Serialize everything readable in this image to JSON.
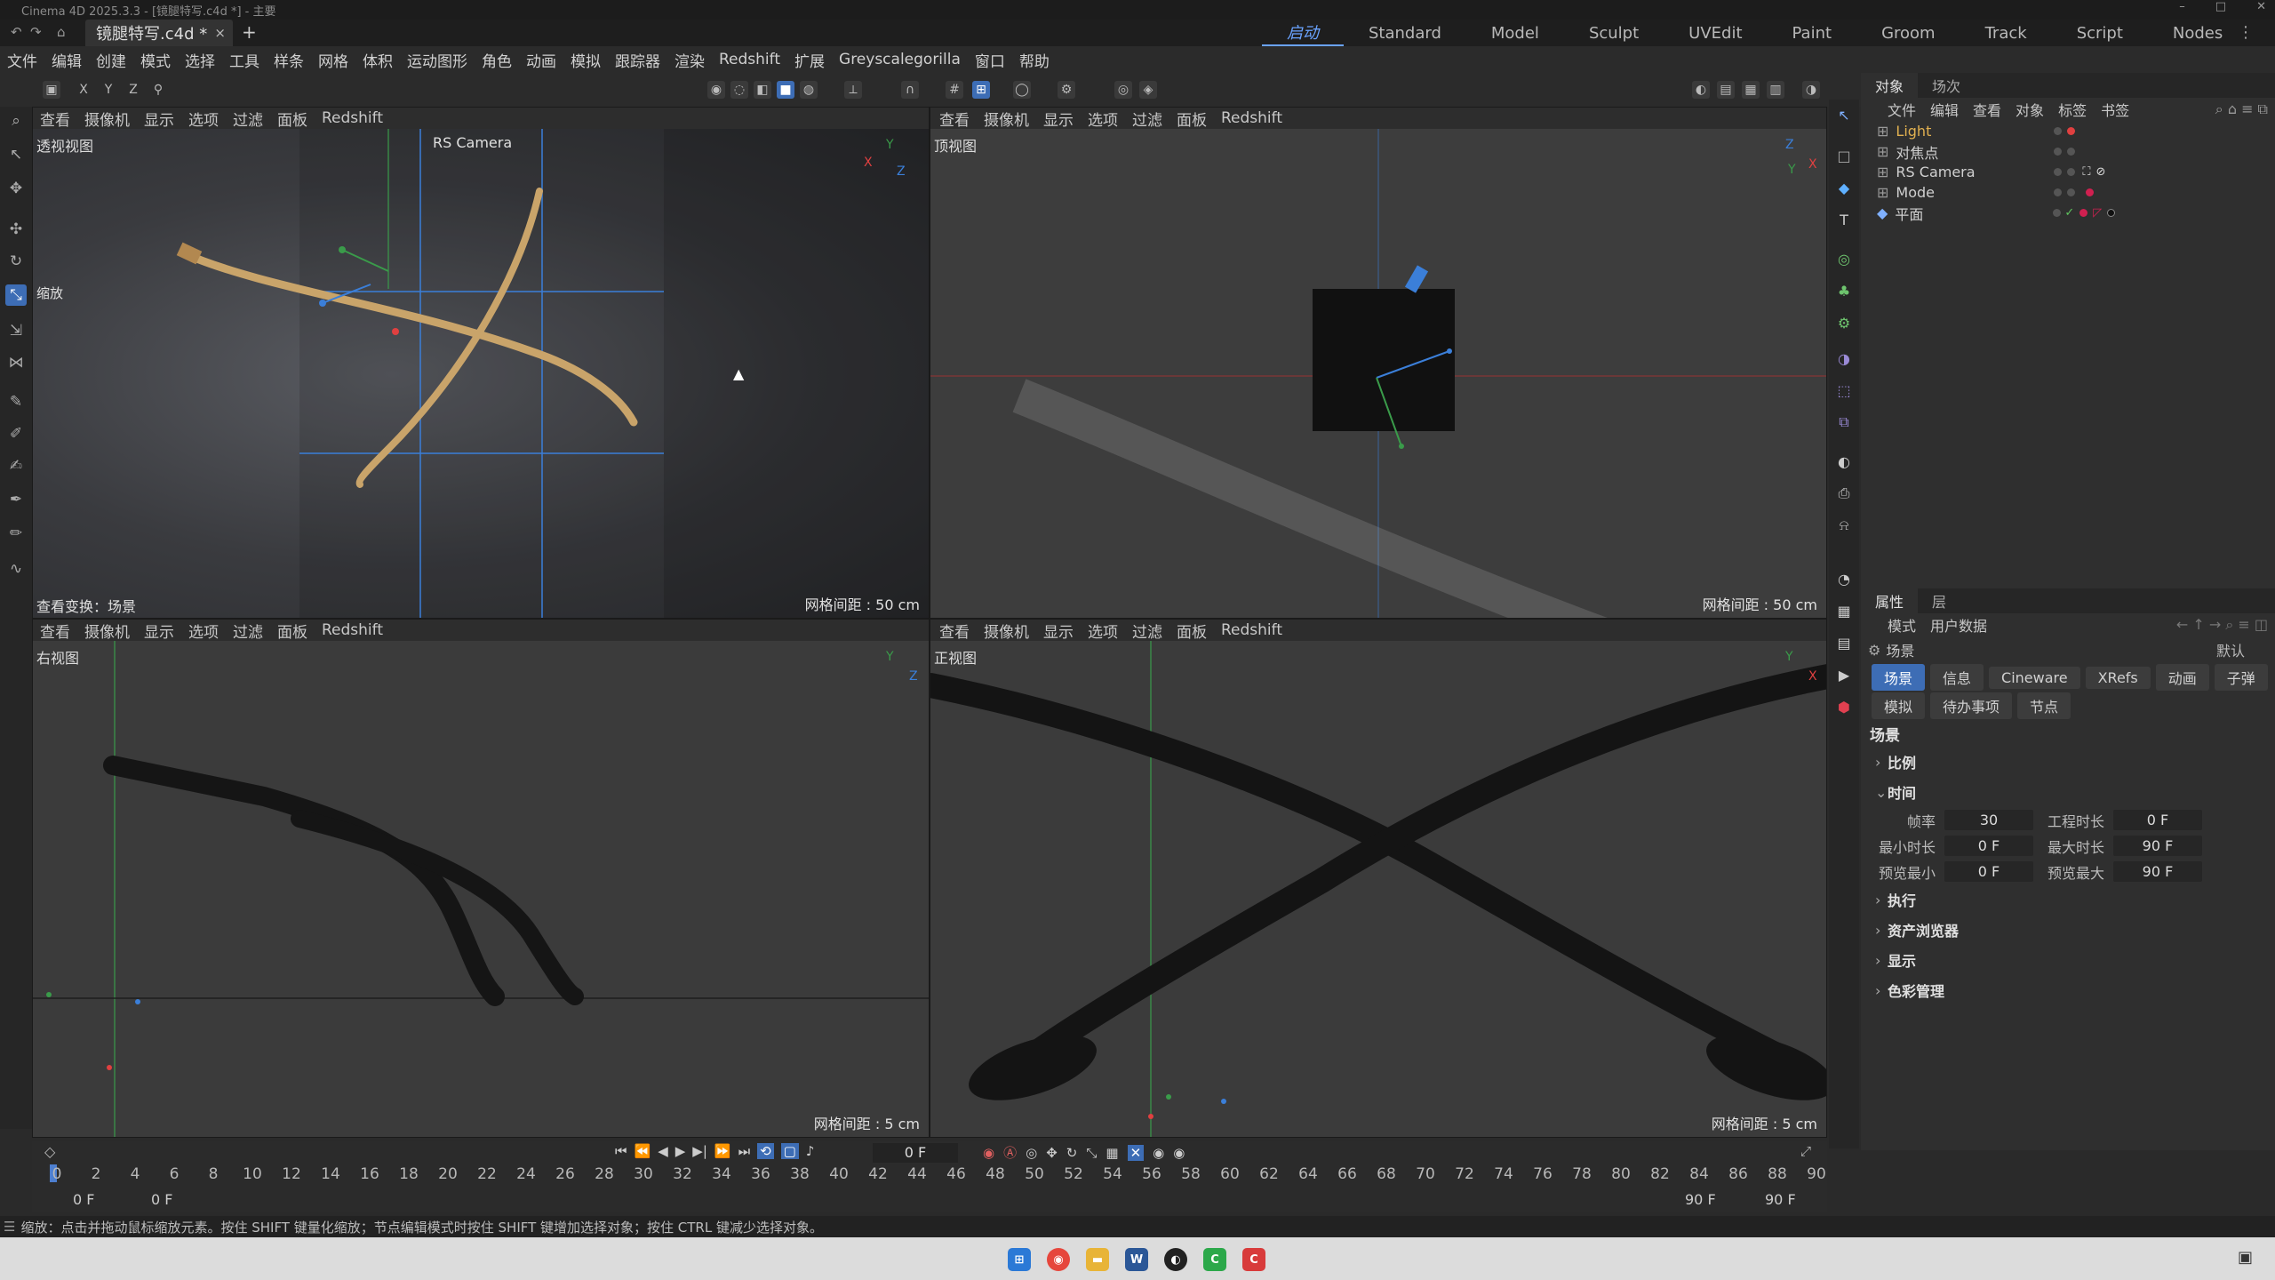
{
  "window": {
    "title": "Cinema 4D 2025.3.3 - [镜腿特写.c4d *] - 主要",
    "minimize": "–",
    "maximize": "□",
    "close": "✕"
  },
  "doc_tab": {
    "label": "镜腿特写.c4d *",
    "close": "×",
    "new": "+"
  },
  "layout_tabs": [
    "启动",
    "Standard",
    "Model",
    "Sculpt",
    "UVEdit",
    "Paint",
    "Groom",
    "Track",
    "Script",
    "Nodes"
  ],
  "menu": [
    "文件",
    "编辑",
    "创建",
    "模式",
    "选择",
    "工具",
    "样条",
    "网格",
    "体积",
    "运动图形",
    "角色",
    "动画",
    "模拟",
    "跟踪器",
    "渲染",
    "Redshift",
    "扩展",
    "Greyscalegorilla",
    "窗口",
    "帮助"
  ],
  "axis_locks": [
    "X",
    "Y",
    "Z"
  ],
  "viewport_menu": [
    "查看",
    "摄像机",
    "显示",
    "选项",
    "过滤",
    "面板",
    "Redshift"
  ],
  "viewports": {
    "perspective": {
      "label": "透视视图",
      "camera": "RS Camera",
      "scale": "缩放",
      "footer_left": "查看变换：场景",
      "grid": "网格间距 : 50 cm"
    },
    "top": {
      "label": "顶视图",
      "grid": "网格间距 : 50 cm"
    },
    "right": {
      "label": "右视图",
      "grid": "网格间距 : 5 cm"
    },
    "front": {
      "label": "正视图",
      "grid": "网格间距 : 5 cm"
    }
  },
  "object_panel": {
    "tabs": [
      "对象",
      "场次"
    ],
    "menu": [
      "文件",
      "编辑",
      "查看",
      "对象",
      "标签",
      "书签"
    ],
    "objects": [
      {
        "name": "Light",
        "highlight": true
      },
      {
        "name": "对焦点",
        "highlight": false
      },
      {
        "name": "RS Camera",
        "highlight": false
      },
      {
        "name": "Mode",
        "highlight": false
      },
      {
        "name": "平面",
        "highlight": false
      }
    ]
  },
  "attr_panel": {
    "tabs": [
      "属性",
      "层"
    ],
    "menu": [
      "模式",
      "用户数据"
    ],
    "context": "场景",
    "preset": "默认",
    "buttons_row1": [
      "场景",
      "信息",
      "Cineware",
      "XRefs",
      "动画",
      "子弹"
    ],
    "buttons_row2": [
      "模拟",
      "待办事项",
      "节点"
    ],
    "section_title": "场景",
    "groups": {
      "scale": "比例",
      "time": "时间",
      "exec": "执行",
      "assets": "资产浏览器",
      "display": "显示",
      "color": "色彩管理"
    },
    "time_fields": {
      "fps_label": "帧率",
      "fps": "30",
      "proj_label": "工程时长",
      "proj": "0 F",
      "min_label": "最小时长",
      "min": "0 F",
      "max_label": "最大时长",
      "max": "90 F",
      "pmin_label": "预览最小",
      "pmin": "0 F",
      "pmax_label": "预览最大",
      "pmax": "90 F"
    }
  },
  "timeline": {
    "current_frame": "0 F",
    "ruler": [
      "0",
      "2",
      "4",
      "6",
      "8",
      "10",
      "12",
      "14",
      "16",
      "18",
      "20",
      "22",
      "24",
      "26",
      "28",
      "30",
      "32",
      "34",
      "36",
      "38",
      "40",
      "42",
      "44",
      "46",
      "48",
      "50",
      "52",
      "54",
      "56",
      "58",
      "60",
      "62",
      "64",
      "66",
      "68",
      "70",
      "72",
      "74",
      "76",
      "78",
      "80",
      "82",
      "84",
      "86",
      "88",
      "90"
    ],
    "start": "0 F",
    "start2": "0 F",
    "end": "90 F",
    "end2": "90 F"
  },
  "status": "缩放：点击并拖动鼠标缩放元素。按住 SHIFT 键量化缩放；节点编辑模式时按住 SHIFT 键增加选择对象；按住 CTRL 键减少选择对象。",
  "colors": {
    "accent": "#3d6db5",
    "light_object": "#e0b050",
    "viewport_bg": "#3b3b3b",
    "panel_bg": "#2f2f2f"
  }
}
